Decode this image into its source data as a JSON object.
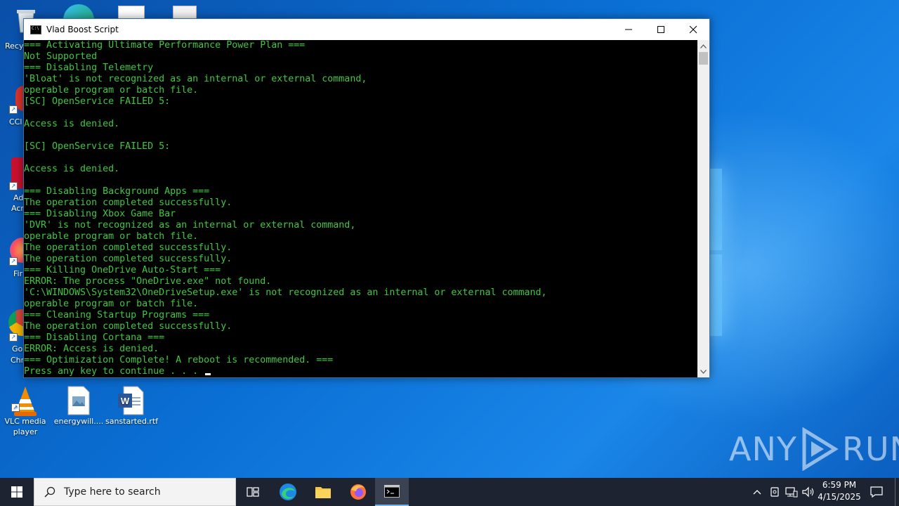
{
  "window": {
    "title": "Vlad Boost Script",
    "lines": [
      "=== Activating Ultimate Performance Power Plan ===",
      "Not Supported",
      "=== Disabling Telemetry",
      "'Bloat' is not recognized as an internal or external command,",
      "operable program or batch file.",
      "[SC] OpenService FAILED 5:",
      "",
      "Access is denied.",
      "",
      "[SC] OpenService FAILED 5:",
      "",
      "Access is denied.",
      "",
      "=== Disabling Background Apps ===",
      "The operation completed successfully.",
      "=== Disabling Xbox Game Bar",
      "'DVR' is not recognized as an internal or external command,",
      "operable program or batch file.",
      "The operation completed successfully.",
      "The operation completed successfully.",
      "=== Killing OneDrive Auto-Start ===",
      "ERROR: The process \"OneDrive.exe\" not found.",
      "'C:\\WINDOWS\\System32\\OneDriveSetup.exe' is not recognized as an internal or external command,",
      "operable program or batch file.",
      "=== Cleaning Startup Programs ===",
      "The operation completed successfully.",
      "=== Disabling Cortana ===",
      "ERROR: Access is denied.",
      "=== Optimization Complete! A reboot is recommended. ==="
    ],
    "prompt": "Press any key to continue . . . "
  },
  "desktop": {
    "icons": [
      {
        "label": "VLC media player"
      },
      {
        "label": "energywill...."
      },
      {
        "label": "sanstarted.rtf"
      }
    ],
    "partial_labels": [
      "Recy",
      "CCl",
      "Ad",
      "Acr",
      "Fir",
      "Go",
      "Chr"
    ]
  },
  "watermark": {
    "text_left": "ANY",
    "text_right": "RUN"
  },
  "taskbar": {
    "search_placeholder": "Type here to search",
    "time": "6:59 PM",
    "date": "4/15/2025"
  },
  "colors": {
    "console_text": "#3ec83e",
    "taskbar": "#1d2330",
    "accent": "#76b9ed"
  }
}
